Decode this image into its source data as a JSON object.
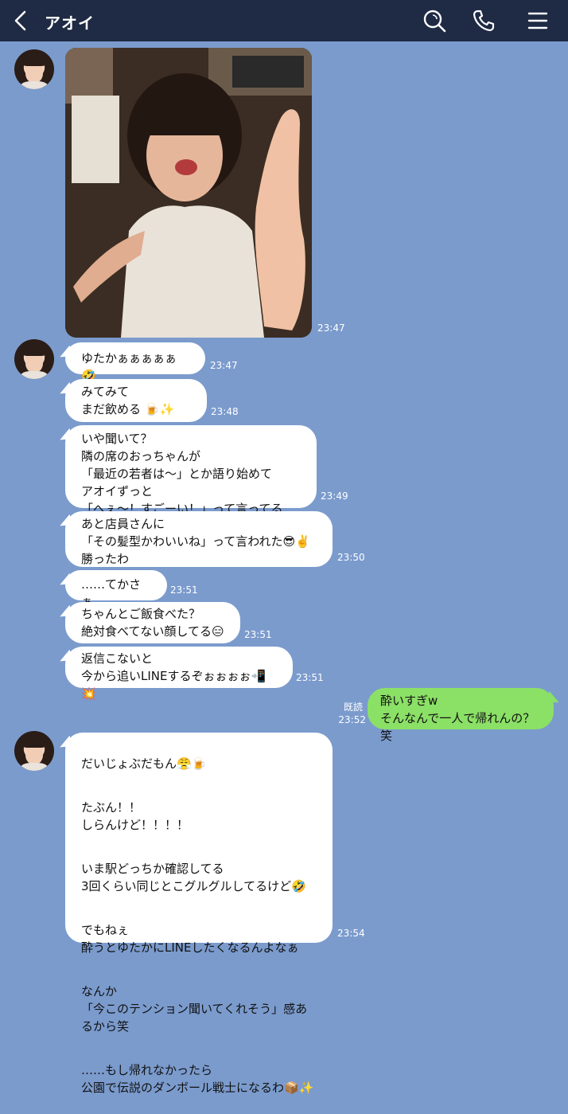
{
  "header": {
    "title": "アオイ",
    "back_icon": "chevron-left-icon",
    "search_icon": "search-icon",
    "call_icon": "phone-icon",
    "menu_icon": "menu-icon",
    "bg_color": "#1f2a44"
  },
  "chat_bg_color": "#7b9bcd",
  "messages": [
    {
      "type": "image",
      "time": "23:47"
    },
    {
      "text": "ゆたかぁぁぁぁぁ🤣",
      "time": "23:47"
    },
    {
      "text": "みてみて\nまだ飲める 🍺✨",
      "time": "23:48"
    },
    {
      "text": "いや聞いて？\n隣の席のおっちゃんが\n「最近の若者は〜」とか語り始めて\nアオイずっと\n「へぇ〜！すごーい！」って言ってるww",
      "time": "23:49"
    },
    {
      "text": "あと店員さんに\n「その髪型かわいいね」って言われた😎✌️\n勝ったわ",
      "time": "23:50"
    },
    {
      "text": "……てかさぁ",
      "time": "23:51"
    },
    {
      "text": "ちゃんとご飯食べた？\n絶対食べてない顔してる😑",
      "time": "23:51"
    },
    {
      "text": "返信こないと\n今から追いLINEするぞぉぉぉぉ📲💥",
      "time": "23:51"
    },
    {
      "text": "酔いすぎw\nそんなんで一人で帰れんの？笑",
      "time": "23:52",
      "read": "既読",
      "mine": true
    },
    {
      "paragraphs": [
        "だいじょぶだもん😤🍺",
        "たぶん！！\nしらんけど！！！！",
        "いま駅どっちか確認してる\n3回くらい同じとこグルグルしてるけど🤣",
        "でもねぇ\n酔うとゆたかにLINEしたくなるんよなぁ",
        "なんか\n「今このテンション聞いてくれそう」感あるから笑",
        "……もし帰れなかったら\n公園で伝説のダンボール戦士になるわ📦✨"
      ],
      "time": "23:54"
    }
  ]
}
